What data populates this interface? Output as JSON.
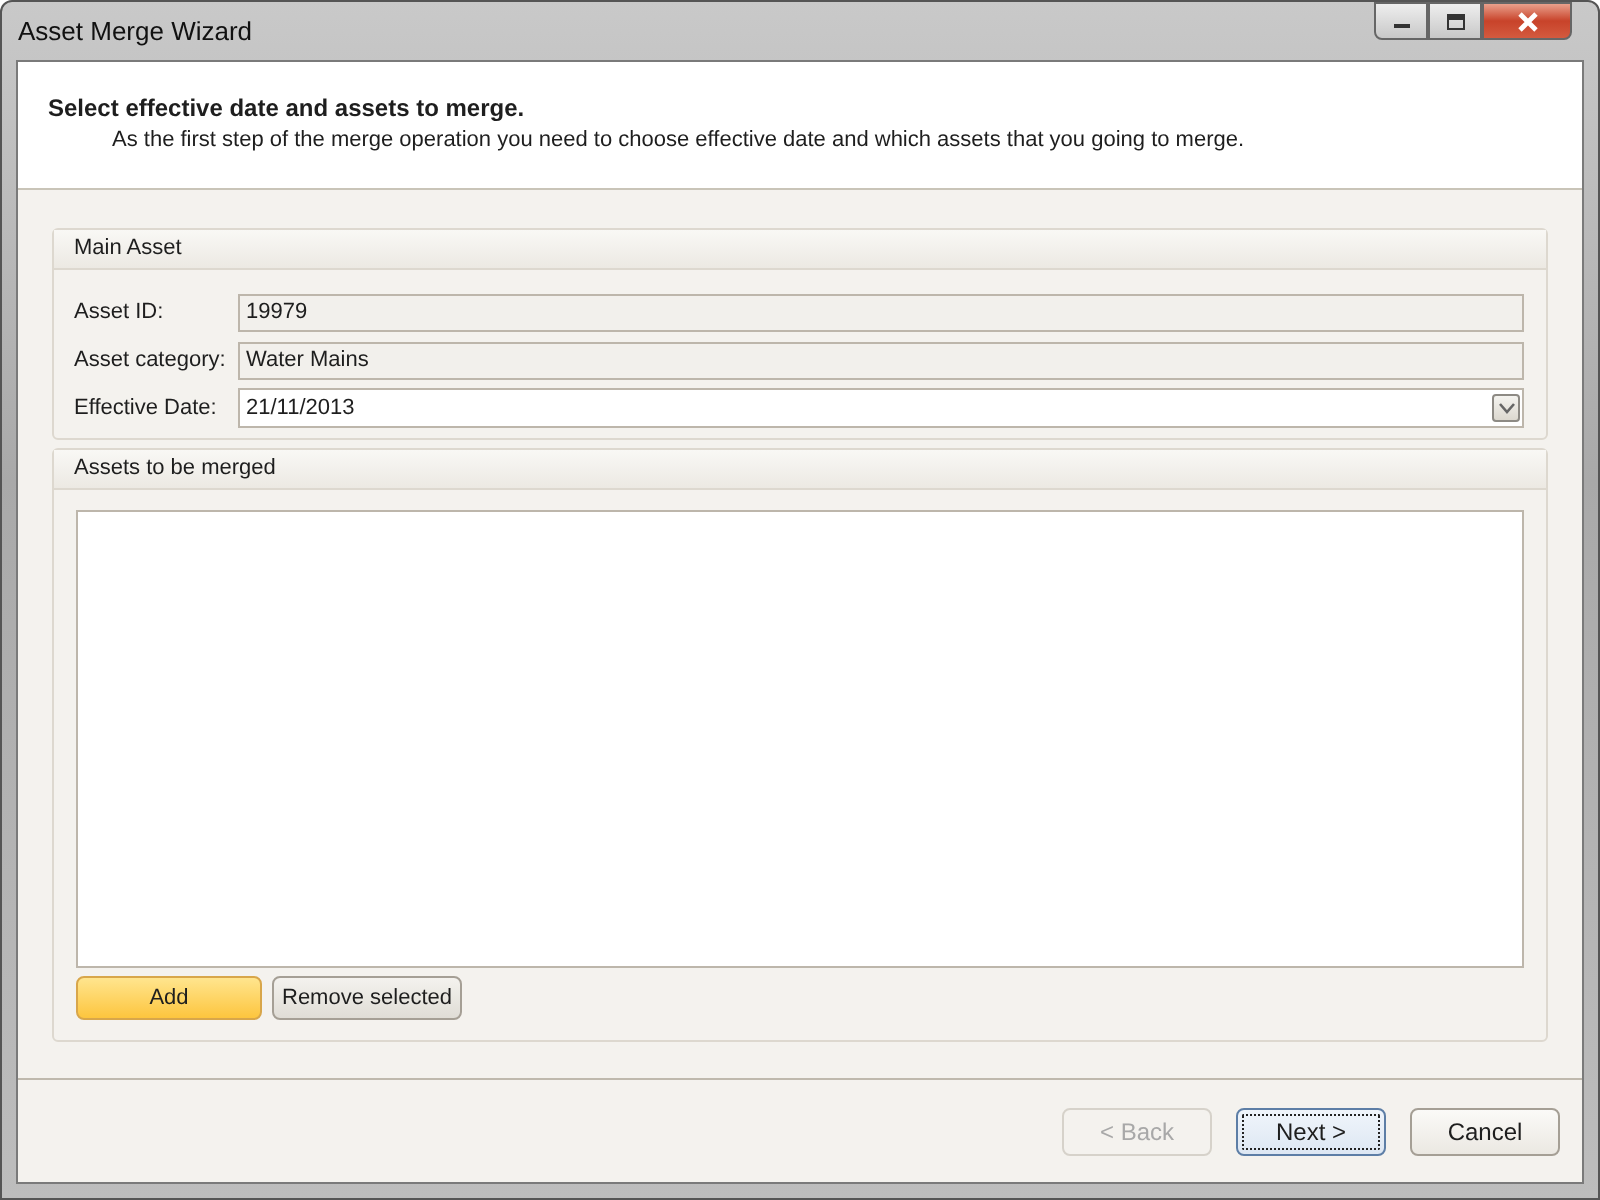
{
  "window": {
    "title": "Asset Merge Wizard"
  },
  "header": {
    "title": "Select effective date and assets to merge.",
    "description": "As the first step of the merge operation you need to choose effective date and which assets that you going to merge."
  },
  "main_asset": {
    "title": "Main Asset",
    "fields": [
      {
        "label": "Asset ID:",
        "value": "19979",
        "kind": "readonly"
      },
      {
        "label": "Asset category:",
        "value": "Water Mains",
        "kind": "readonly"
      },
      {
        "label": "Effective Date:",
        "value": "21/11/2013",
        "kind": "date"
      }
    ]
  },
  "assets_to_merge": {
    "title": "Assets to be merged",
    "buttons": [
      {
        "label": "Add",
        "highlighted": true
      },
      {
        "label": "Remove selected",
        "highlighted": false
      }
    ]
  },
  "footer_buttons": [
    {
      "label": "< Back",
      "disabled": true,
      "focused": false
    },
    {
      "label": "Next >",
      "disabled": false,
      "focused": true
    },
    {
      "label": "Cancel",
      "disabled": false,
      "focused": false
    }
  ]
}
